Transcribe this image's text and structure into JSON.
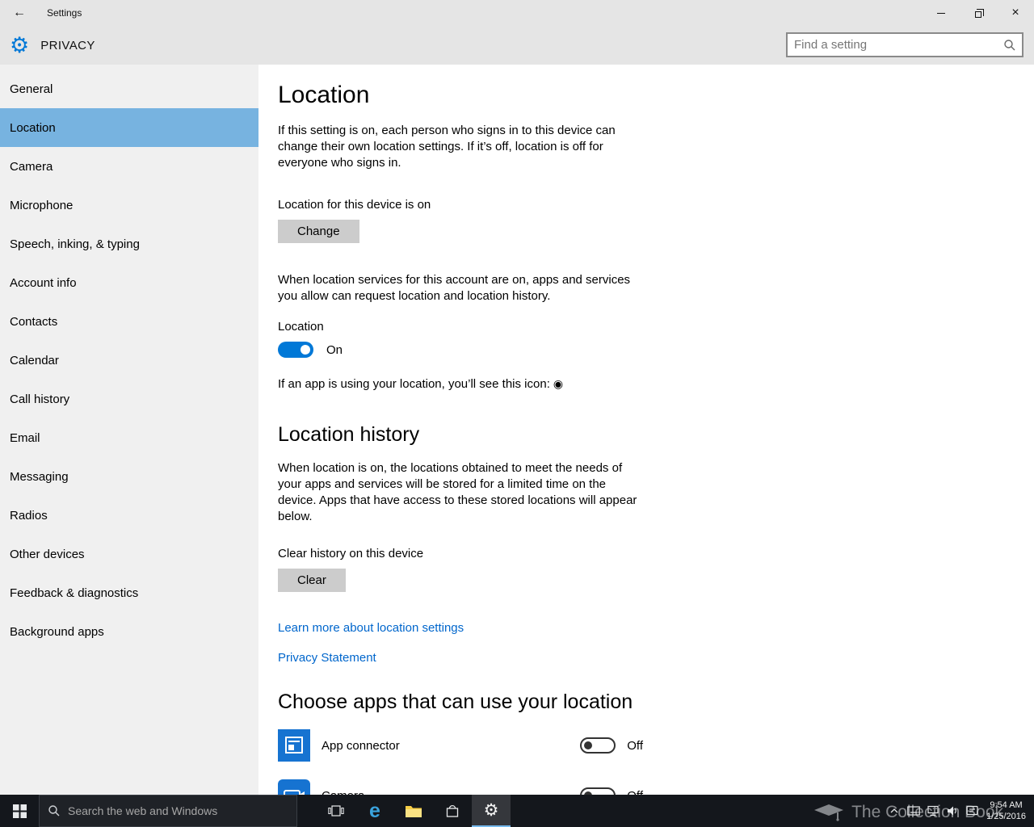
{
  "titlebar": {
    "title": "Settings"
  },
  "icons": {
    "back": "←",
    "gear": "⚙",
    "close": "×",
    "location_in_use": "◉",
    "edge": "e"
  },
  "header": {
    "title": "PRIVACY",
    "search_placeholder": "Find a setting"
  },
  "sidebar": {
    "selected": "Location",
    "items": [
      {
        "label": "General"
      },
      {
        "label": "Location"
      },
      {
        "label": "Camera"
      },
      {
        "label": "Microphone"
      },
      {
        "label": "Speech, inking, & typing"
      },
      {
        "label": "Account info"
      },
      {
        "label": "Contacts"
      },
      {
        "label": "Calendar"
      },
      {
        "label": "Call history"
      },
      {
        "label": "Email"
      },
      {
        "label": "Messaging"
      },
      {
        "label": "Radios"
      },
      {
        "label": "Other devices"
      },
      {
        "label": "Feedback & diagnostics"
      },
      {
        "label": "Background apps"
      }
    ]
  },
  "main": {
    "title": "Location",
    "intro": "If this setting is on, each person who signs in to this device can change their own location settings. If it’s off, location is off for everyone who signs in.",
    "device_status": "Location for this device is on",
    "change_button": "Change",
    "account_text": "When location services for this account are on, apps and services you allow can request location and location history.",
    "location_toggle_label": "Location",
    "location_toggle_state": "On",
    "icon_note": "If an app is using your location, you’ll see this icon:",
    "history": {
      "title": "Location history",
      "text": "When location is on, the locations obtained to meet the needs of your apps and services will be stored for a limited time on the device. Apps that have access to these stored locations will appear below.",
      "clear_label": "Clear history on this device",
      "clear_button": "Clear"
    },
    "links": {
      "learn_more": "Learn more about location settings",
      "privacy": "Privacy Statement"
    },
    "apps": {
      "title": "Choose apps that can use your location",
      "items": [
        {
          "name": "App connector",
          "state": "Off"
        },
        {
          "name": "Camera",
          "state": "Off"
        }
      ]
    }
  },
  "taskbar": {
    "search_placeholder": "Search the web and Windows",
    "time": "9:54 AM",
    "date": "1/25/2016"
  },
  "watermark": {
    "text": "The Collection Book"
  },
  "colors": {
    "accent": "#0078d7",
    "sidebar_selected": "#77b3e0",
    "link": "#0066cc",
    "taskbar": "#14171c"
  }
}
